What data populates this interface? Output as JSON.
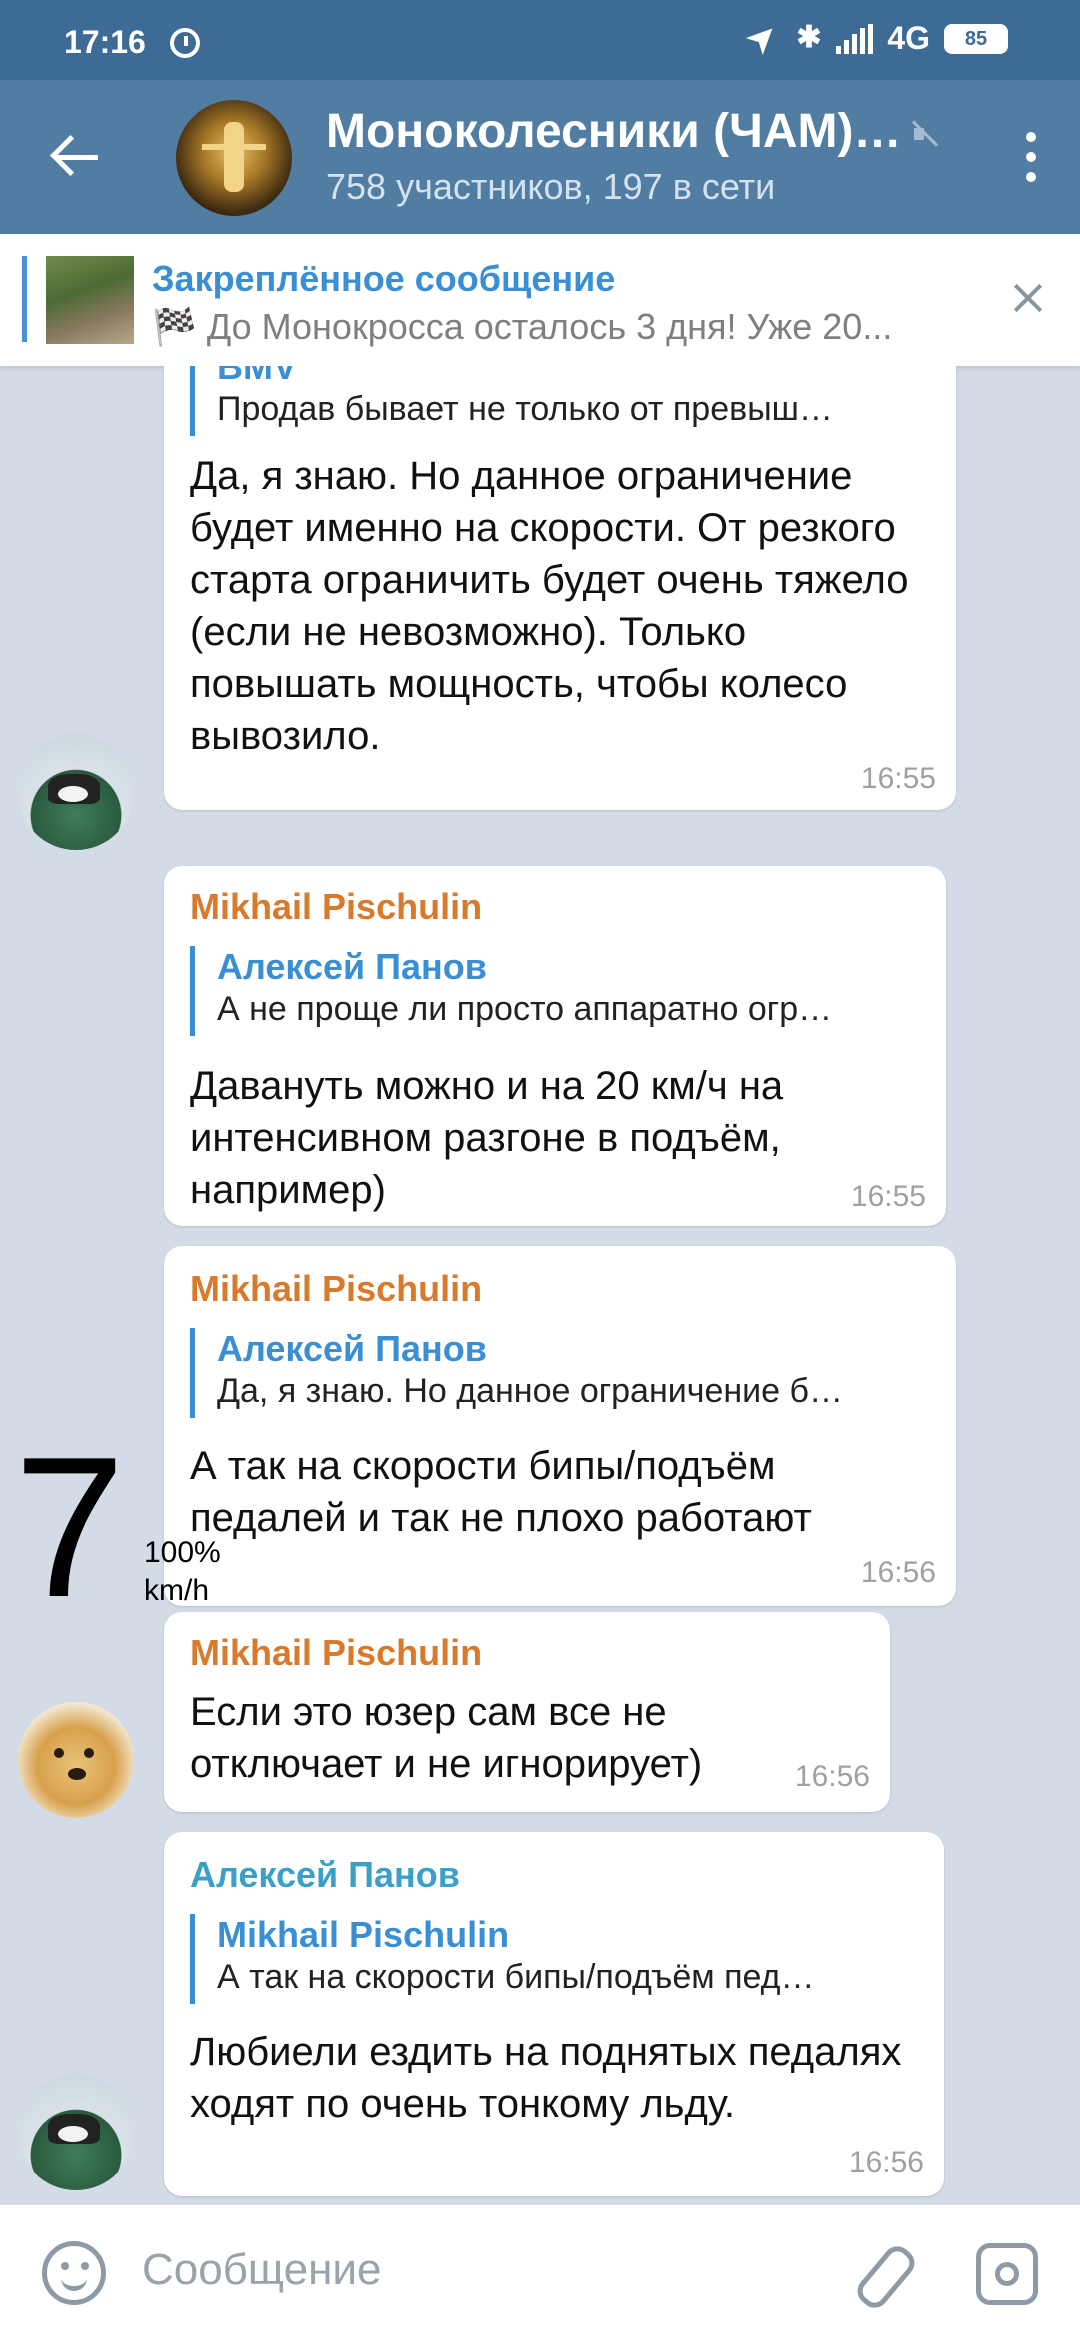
{
  "status_bar": {
    "time": "17:16",
    "network": "4G",
    "battery": "85"
  },
  "header": {
    "title": "Моноколесники (ЧАМ)…",
    "subtitle": "758 участников, 197 в сети"
  },
  "pinned": {
    "title": "Закреплённое сообщение",
    "text": "🏁 До Монокросса осталось 3 дня! Уже 20..."
  },
  "messages": [
    {
      "reply_name": "BMV",
      "reply_text": "Продав бывает не только от превыш…",
      "text": "Да, я знаю. Но данное ограничение будет именно на скорости. От резкого старта ограничить будет очень тяжело (если не невозможно). Только повышать мощность, чтобы колесо вывозило.",
      "time": "16:55"
    },
    {
      "sender": "Mikhail Pischulin",
      "reply_name": "Алексей Панов",
      "reply_text": "А не проще ли просто аппаратно огр…",
      "text": "Давануть можно и на 20 км/ч на интенсивном разгоне в подъём, например)",
      "time": "16:55"
    },
    {
      "sender": "Mikhail Pischulin",
      "reply_name": "Алексей Панов",
      "reply_text": "Да, я знаю. Но данное ограничение б…",
      "text": "А так на скорости бипы/подъём педалей и так не плохо работают",
      "time": "16:56"
    },
    {
      "sender": "Mikhail Pischulin",
      "text": "Если это юзер сам все не отключает и не игнорирует)",
      "time": "16:56"
    },
    {
      "sender": "Алексей Панов",
      "reply_name": "Mikhail Pischulin",
      "reply_text": "А так на скорости бипы/подъём пед…",
      "text": "Любиели ездить на поднятых педалях ходят по очень тонкому льду.",
      "time": "16:56"
    }
  ],
  "speed_overlay": {
    "value": "7",
    "percent": "100%",
    "unit": "km/h"
  },
  "input": {
    "placeholder": "Сообщение"
  },
  "colors": {
    "header": "#517da2",
    "statusbar": "#3e6a96",
    "sender_orange": "#d9792c",
    "sender_blue": "#3aa0c6",
    "link_blue": "#3a8fd4"
  }
}
